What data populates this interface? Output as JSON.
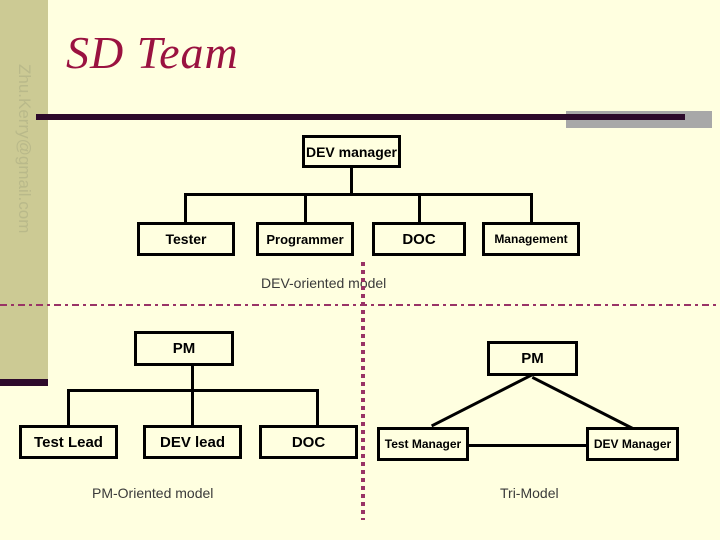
{
  "slide": {
    "title": "SD Team",
    "watermark": "Zhu.Kerry@gmail.com",
    "background_color": "#ffffe0",
    "sidebar_color": "#ccca94",
    "title_color": "#9a1240",
    "rule_color": "#2d0a2b",
    "divider_color": "#993366"
  },
  "dev_chart": {
    "caption": "DEV-oriented model",
    "root": "DEV manager",
    "children": [
      "Tester",
      "Programmer",
      "DOC",
      "Management"
    ]
  },
  "pm_chart": {
    "caption": "PM-Oriented model",
    "root": "PM",
    "children": [
      "Test Lead",
      "DEV lead",
      "DOC"
    ]
  },
  "tri_chart": {
    "caption": "Tri-Model",
    "top": "PM",
    "left": "Test Manager",
    "right": "DEV Manager"
  }
}
